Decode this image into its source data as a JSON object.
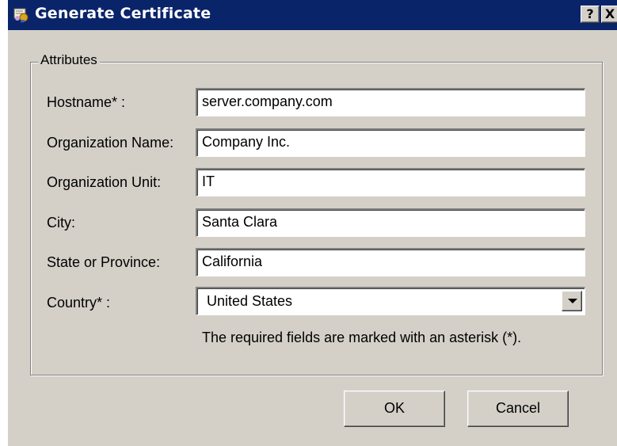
{
  "window": {
    "title": "Generate Certificate",
    "help_label": "?",
    "close_label": "X"
  },
  "group": {
    "legend": "Attributes"
  },
  "fields": {
    "hostname": {
      "label": "Hostname* :",
      "value": "server.company.com"
    },
    "org_name": {
      "label": "Organization Name:",
      "value": "Company Inc."
    },
    "org_unit": {
      "label": "Organization Unit:",
      "value": "IT"
    },
    "city": {
      "label": "City:",
      "value": "Santa Clara"
    },
    "state": {
      "label": "State or Province:",
      "value": "California"
    },
    "country": {
      "label": "Country* :",
      "value": "United States"
    }
  },
  "hint": "The required fields are marked with an asterisk (*).",
  "buttons": {
    "ok": "OK",
    "cancel": "Cancel"
  },
  "colors": {
    "titlebar": "#0a246a",
    "face": "#d4d0c8"
  }
}
